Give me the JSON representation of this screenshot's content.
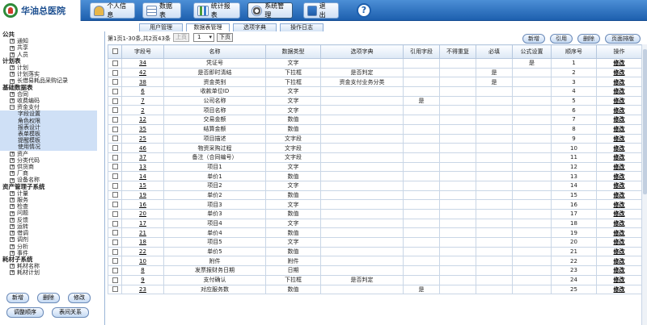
{
  "app": {
    "name": "华油总医院"
  },
  "nav": [
    {
      "label": "个人信息",
      "icon": "user-icon"
    },
    {
      "label": "数据表",
      "icon": "table-icon"
    },
    {
      "label": "统计报表",
      "icon": "chart-icon"
    },
    {
      "label": "系统管理",
      "icon": "gear-icon"
    },
    {
      "label": "退　出",
      "icon": "exit-icon"
    }
  ],
  "help": "?",
  "tabs": [
    "用户管理",
    "数据表管理",
    "选项字典",
    "操作日志"
  ],
  "sidebar": {
    "sections": [
      {
        "title": "公共",
        "items": [
          "通知",
          "共享",
          "人员"
        ]
      },
      {
        "title": "计划表",
        "items": [
          "计划",
          "计划落实",
          "长借易耗品采购记录"
        ]
      },
      {
        "title": "基础数据表",
        "items": [
          "合同",
          "收费编码",
          "资金支付"
        ],
        "subitems": [
          "字段设置",
          "角色权限",
          "报表设计",
          "表单模板",
          "提醒模板",
          "使用情况"
        ],
        "after": [
          "资产",
          "分类代码",
          "供货商",
          "厂商",
          "设备名称"
        ]
      },
      {
        "title": "资产管理子系统",
        "items": [
          "计量",
          "服务",
          "检查",
          "问题",
          "反馈",
          "运转",
          "借调",
          "调剂",
          "分析",
          "事件"
        ]
      },
      {
        "title": "耗材子系统",
        "items": [
          "耗材名称",
          "耗材计划"
        ]
      }
    ],
    "buttons": [
      "新增",
      "删除",
      "修改",
      "调整顺序",
      "表间关系"
    ]
  },
  "toolbar": {
    "page_info": "第1页1-30条,共2页43条",
    "prev": "上页",
    "page_value": "1",
    "next": "下页",
    "new": "新增",
    "ref": "引用",
    "delete": "删除",
    "sort": "页面排版"
  },
  "columns": [
    "字段号",
    "名称",
    "数据类型",
    "选项字典",
    "引用字段",
    "不得重复",
    "必填",
    "公式设置",
    "顺序号",
    "操作"
  ],
  "rows": [
    [
      "34",
      "凭证号",
      "文字",
      "",
      "",
      "",
      "",
      "是",
      "1",
      "修改"
    ],
    [
      "42",
      "是否即时清结",
      "下拉框",
      "是否判定",
      "",
      "",
      "是",
      "",
      "2",
      "修改"
    ],
    [
      "38",
      "资金类别",
      "下拉框",
      "资金支付业务分类",
      "",
      "",
      "是",
      "",
      "3",
      "修改"
    ],
    [
      "6",
      "收款单位ID",
      "文字",
      "",
      "",
      "",
      "",
      "",
      "4",
      "修改"
    ],
    [
      "7",
      "公司名称",
      "文字",
      "",
      "是",
      "",
      "",
      "",
      "5",
      "修改"
    ],
    [
      "2",
      "项目名称",
      "文字",
      "",
      "",
      "",
      "",
      "",
      "6",
      "修改"
    ],
    [
      "12",
      "交易金额",
      "数值",
      "",
      "",
      "",
      "",
      "",
      "7",
      "修改"
    ],
    [
      "35",
      "结算金额",
      "数值",
      "",
      "",
      "",
      "",
      "",
      "8",
      "修改"
    ],
    [
      "25",
      "项目描述",
      "文字段",
      "",
      "",
      "",
      "",
      "",
      "9",
      "修改"
    ],
    [
      "46",
      "物资采购过程",
      "文字段",
      "",
      "",
      "",
      "",
      "",
      "10",
      "修改"
    ],
    [
      "37",
      "备注（合同编号）",
      "文字段",
      "",
      "",
      "",
      "",
      "",
      "11",
      "修改"
    ],
    [
      "13",
      "项目1",
      "文字",
      "",
      "",
      "",
      "",
      "",
      "12",
      "修改"
    ],
    [
      "14",
      "单价1",
      "数值",
      "",
      "",
      "",
      "",
      "",
      "13",
      "修改"
    ],
    [
      "15",
      "项目2",
      "文字",
      "",
      "",
      "",
      "",
      "",
      "14",
      "修改"
    ],
    [
      "19",
      "单价2",
      "数值",
      "",
      "",
      "",
      "",
      "",
      "15",
      "修改"
    ],
    [
      "16",
      "项目3",
      "文字",
      "",
      "",
      "",
      "",
      "",
      "16",
      "修改"
    ],
    [
      "20",
      "单价3",
      "数值",
      "",
      "",
      "",
      "",
      "",
      "17",
      "修改"
    ],
    [
      "17",
      "项目4",
      "文字",
      "",
      "",
      "",
      "",
      "",
      "18",
      "修改"
    ],
    [
      "21",
      "单价4",
      "数值",
      "",
      "",
      "",
      "",
      "",
      "19",
      "修改"
    ],
    [
      "18",
      "项目5",
      "文字",
      "",
      "",
      "",
      "",
      "",
      "20",
      "修改"
    ],
    [
      "22",
      "单价5",
      "数值",
      "",
      "",
      "",
      "",
      "",
      "21",
      "修改"
    ],
    [
      "10",
      "附件",
      "附件",
      "",
      "",
      "",
      "",
      "",
      "22",
      "修改"
    ],
    [
      "8",
      "发票报财务日期",
      "日期",
      "",
      "",
      "",
      "",
      "",
      "23",
      "修改"
    ],
    [
      "9",
      "支付确认",
      "下拉框",
      "是否判定",
      "",
      "",
      "",
      "",
      "24",
      "修改"
    ],
    [
      "23",
      "对应服务数",
      "数值",
      "",
      "是",
      "",
      "",
      "",
      "25",
      "修改"
    ]
  ]
}
